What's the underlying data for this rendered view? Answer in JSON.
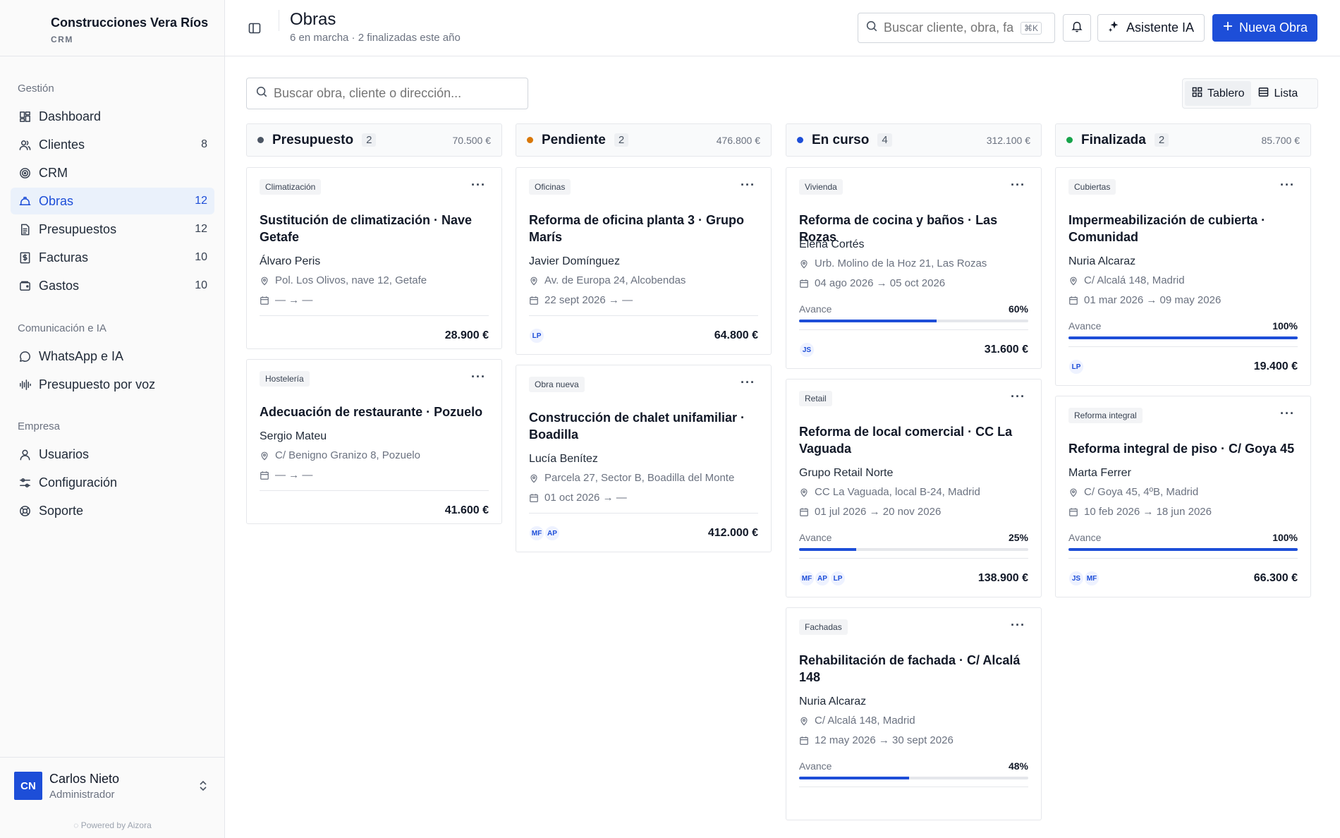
{
  "brand": {
    "name": "Construcciones Vera Ríos",
    "sub": "CRM"
  },
  "sidebar": {
    "sections": [
      {
        "title": "Gestión",
        "items": [
          {
            "label": "Dashboard",
            "count": "",
            "icon": "dashboard-icon"
          },
          {
            "label": "Clientes",
            "count": "8",
            "icon": "users-icon"
          },
          {
            "label": "CRM",
            "count": "",
            "icon": "target-icon"
          },
          {
            "label": "Obras",
            "count": "12",
            "icon": "hardhat-icon",
            "active": true
          },
          {
            "label": "Presupuestos",
            "count": "12",
            "icon": "document-icon"
          },
          {
            "label": "Facturas",
            "count": "10",
            "icon": "invoice-icon"
          },
          {
            "label": "Gastos",
            "count": "10",
            "icon": "wallet-icon"
          }
        ]
      },
      {
        "title": "Comunicación e IA",
        "items": [
          {
            "label": "WhatsApp e IA",
            "count": "",
            "icon": "chat-icon"
          },
          {
            "label": "Presupuesto por voz",
            "count": "",
            "icon": "waveform-icon"
          }
        ]
      },
      {
        "title": "Empresa",
        "items": [
          {
            "label": "Usuarios",
            "count": "",
            "icon": "user-icon"
          },
          {
            "label": "Configuración",
            "count": "",
            "icon": "settings-icon"
          },
          {
            "label": "Soporte",
            "count": "",
            "icon": "lifebuoy-icon"
          }
        ]
      }
    ]
  },
  "user": {
    "initials": "CN",
    "name": "Carlos Nieto",
    "role": "Administrador",
    "powered": "Powered by Aizora"
  },
  "header": {
    "title": "Obras",
    "subtitle": "6 en marcha · 2 finalizadas este año",
    "search_placeholder": "Buscar cliente, obra, fa",
    "search_kbd": "⌘K",
    "ai_label": "Asistente IA",
    "new_label": "Nueva Obra"
  },
  "board": {
    "search_placeholder": "Buscar obra, cliente o dirección...",
    "view_board": "Tablero",
    "view_list": "Lista",
    "columns": [
      {
        "title": "Presupuesto",
        "count": "2",
        "total": "70.500 €",
        "color": "#4b5563",
        "cards": [
          {
            "tag": "Climatización",
            "title": "Sustitución de climatización · Nave Getafe",
            "client": "Álvaro Peris",
            "address": "Pol. Los Olivos, nave 12, Getafe",
            "dates": "— → —",
            "progress": null,
            "avatars": [],
            "amount": "28.900 €"
          },
          {
            "tag": "Hostelería",
            "title": "Adecuación de restaurante · Pozuelo",
            "client": "Sergio Mateu",
            "address": "C/ Benigno Granizo 8, Pozuelo",
            "dates": "— → —",
            "progress": null,
            "avatars": [],
            "amount": "41.600 €"
          }
        ]
      },
      {
        "title": "Pendiente",
        "count": "2",
        "total": "476.800 €",
        "color": "#d97706",
        "cards": [
          {
            "tag": "Oficinas",
            "title": "Reforma de oficina planta 3 · Grupo Marís",
            "client": "Javier Domínguez",
            "address": "Av. de Europa 24, Alcobendas",
            "dates": "22 sept 2026 → —",
            "progress": null,
            "avatars": [
              "LP"
            ],
            "amount": "64.800 €"
          },
          {
            "tag": "Obra nueva",
            "title": "Construcción de chalet unifamiliar · Boadilla",
            "client": "Lucía Benítez",
            "address": "Parcela 27, Sector B, Boadilla del Monte",
            "dates": "01 oct 2026 → —",
            "progress": null,
            "avatars": [
              "MF",
              "AP"
            ],
            "amount": "412.000 €"
          }
        ]
      },
      {
        "title": "En curso",
        "count": "4",
        "total": "312.100 €",
        "color": "#1d4ed8",
        "cards": [
          {
            "tag": "Vivienda",
            "title": "Reforma de cocina y baños · Las Rozas",
            "client": "Elena Cortés",
            "address": "Urb. Molino de la Hoz 21, Las Rozas",
            "dates": "04 ago 2026 → 05 oct 2026",
            "progress_label": "Avance",
            "progress": 60,
            "progress_text": "60%",
            "avatars": [
              "JS"
            ],
            "amount": "31.600 €"
          },
          {
            "tag": "Retail",
            "title": "Reforma de local comercial · CC La Vaguada",
            "client": "Grupo Retail Norte",
            "address": "CC La Vaguada, local B-24, Madrid",
            "dates": "01 jul 2026 → 20 nov 2026",
            "progress_label": "Avance",
            "progress": 25,
            "progress_text": "25%",
            "avatars": [
              "MF",
              "AP",
              "LP"
            ],
            "amount": "138.900 €"
          },
          {
            "tag": "Fachadas",
            "title": "Rehabilitación de fachada · C/ Alcalá 148",
            "client": "Nuria Alcaraz",
            "address": "C/ Alcalá 148, Madrid",
            "dates": "12 may 2026 → 30 sept 2026",
            "progress_label": "Avance",
            "progress": 48,
            "progress_text": "48%",
            "avatars": [],
            "amount": ""
          }
        ]
      },
      {
        "title": "Finalizada",
        "count": "2",
        "total": "85.700 €",
        "color": "#16a34a",
        "cards": [
          {
            "tag": "Cubiertas",
            "title": "Impermeabilización de cubierta · Comunidad",
            "client": "Nuria Alcaraz",
            "address": "C/ Alcalá 148, Madrid",
            "dates": "01 mar 2026 → 09 may 2026",
            "progress_label": "Avance",
            "progress": 100,
            "progress_text": "100%",
            "avatars": [
              "LP"
            ],
            "amount": "19.400 €"
          },
          {
            "tag": "Reforma integral",
            "title": "Reforma integral de piso · C/ Goya 45",
            "client": "Marta Ferrer",
            "address": "C/ Goya 45, 4ºB, Madrid",
            "dates": "10 feb 2026 → 18 jun 2026",
            "progress_label": "Avance",
            "progress": 100,
            "progress_text": "100%",
            "avatars": [
              "JS",
              "MF"
            ],
            "amount": "66.300 €"
          }
        ]
      }
    ]
  }
}
